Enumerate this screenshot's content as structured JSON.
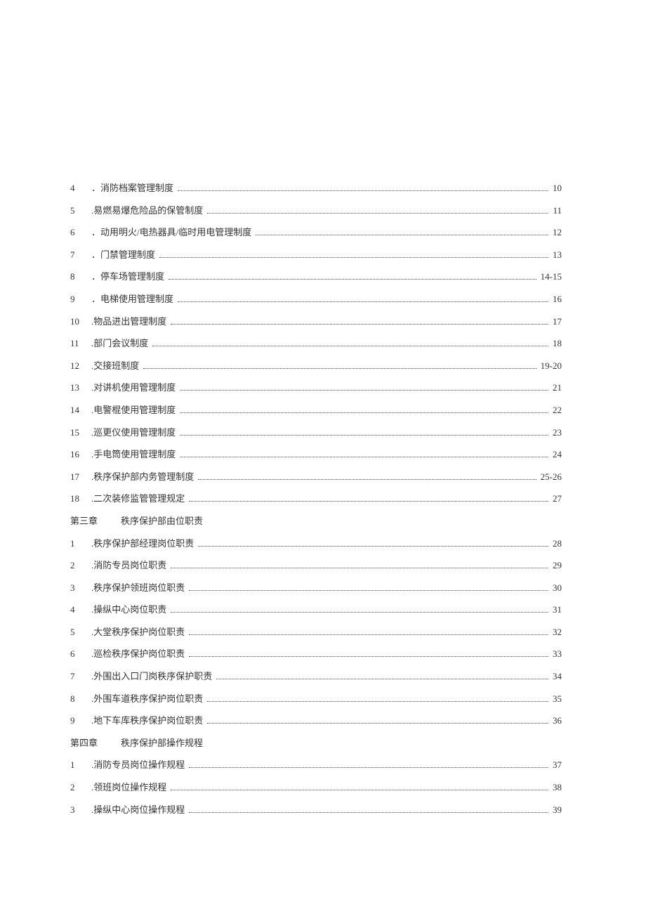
{
  "toc": {
    "items": [
      {
        "num": "4",
        "title": "．消防档案管理制度",
        "page": "10",
        "dots": true
      },
      {
        "num": "5",
        "title": ".易燃易爆危险品的保管制度",
        "page": "11",
        "dots": true
      },
      {
        "num": "6",
        "title": "．动用明火/电热器具/临时用电管理制度",
        "page": "12",
        "dots": true
      },
      {
        "num": "7",
        "title": "．门禁管理制度",
        "page": "13",
        "dots": true
      },
      {
        "num": "8",
        "title": "．停车场管理制度",
        "page": "14-15",
        "dots": true
      },
      {
        "num": "9",
        "title": "．电梯使用管理制度",
        "page": "16",
        "dots": true
      },
      {
        "num": "10",
        "title": ".物品进出管理制度",
        "page": "17",
        "dots": true
      },
      {
        "num": "11",
        "title": ".部门会议制度",
        "page": "18",
        "dots": true
      },
      {
        "num": "12",
        "title": ".交接班制度",
        "page": "19-20",
        "dots": true
      },
      {
        "num": "13",
        "title": ".对讲机使用管理制度",
        "page": "21",
        "dots": true
      },
      {
        "num": "14",
        "title": ".电警棍使用管理制度",
        "page": "22",
        "dots": true
      },
      {
        "num": "15",
        "title": ".巡更仪使用管理制度",
        "page": "23",
        "dots": true
      },
      {
        "num": "16",
        "title": ".手电筒使用管理制度",
        "page": "24",
        "dots": true
      },
      {
        "num": "17",
        "title": ".秩序保护部内务管理制度",
        "page": "25-26",
        "dots": true
      },
      {
        "num": "18",
        "title": ".二次装修监管管理规定",
        "page": "27",
        "dots": true
      },
      {
        "chapter": true,
        "label": "第三章",
        "title": "秩序保护部由位职责"
      },
      {
        "num": "1",
        "title": ".秩序保护部经理岗位职责",
        "page": "28",
        "dots": true
      },
      {
        "num": "2",
        "title": ".消防专员岗位职责",
        "page": "29",
        "dots": true
      },
      {
        "num": "3",
        "title": ".秩序保护领班岗位职责",
        "page": "30",
        "dots": true
      },
      {
        "num": "4",
        "title": ".操纵中心岗位职责",
        "page": "31",
        "dots": true
      },
      {
        "num": "5",
        "title": ".大堂秩序保护岗位职责",
        "page": "32",
        "dots": true
      },
      {
        "num": "6",
        "title": ".巡检秩序保护岗位职责",
        "page": "33",
        "dots": true
      },
      {
        "num": "7",
        "title": ".外围出入口门岗秩序保护职责",
        "page": "34",
        "dots": true
      },
      {
        "num": "8",
        "title": ".外围车道秩序保护岗位职责",
        "page": "35",
        "dots": true
      },
      {
        "num": "9",
        "title": ".地下车库秩序保护岗位职责",
        "page": "36",
        "dots": true
      },
      {
        "chapter": true,
        "label": "第四章",
        "title": "秩序保护部操作规程"
      },
      {
        "num": "1",
        "title": ".消防专员岗位操作规程",
        "page": "37",
        "dots": true
      },
      {
        "num": "2",
        "title": ".领班岗位操作规程",
        "page": "38",
        "dots": true
      },
      {
        "num": "3",
        "title": ".操纵中心岗位操作规程",
        "page": "39",
        "dots": true
      }
    ]
  }
}
